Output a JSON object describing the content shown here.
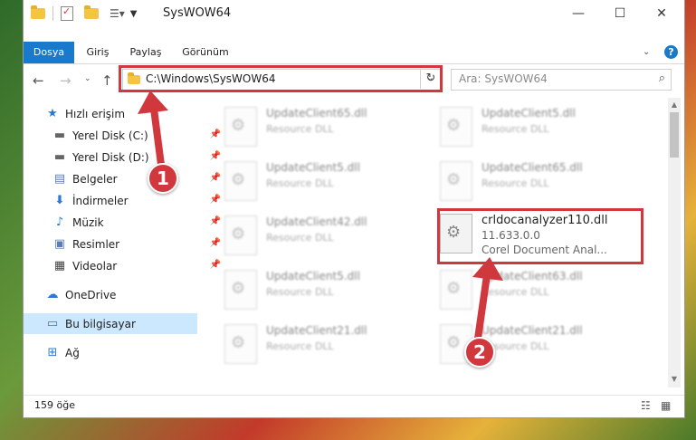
{
  "window": {
    "title": "SysWOW64"
  },
  "ribbon": {
    "tabs": [
      {
        "label": "Dosya",
        "active": true
      },
      {
        "label": "Giriş",
        "active": false
      },
      {
        "label": "Paylaş",
        "active": false
      },
      {
        "label": "Görünüm",
        "active": false
      }
    ],
    "help_label": "?"
  },
  "address": {
    "path": "C:\\Windows\\SysWOW64"
  },
  "search": {
    "placeholder": "Ara: SysWOW64"
  },
  "sidebar": {
    "items": [
      {
        "label": "Hızlı erişim",
        "icon": "star-icon",
        "pinned": false
      },
      {
        "label": "Yerel Disk (C:)",
        "icon": "drive-icon",
        "pinned": true
      },
      {
        "label": "Yerel Disk (D:)",
        "icon": "drive-icon",
        "pinned": true
      },
      {
        "label": "Belgeler",
        "icon": "document-icon",
        "pinned": true
      },
      {
        "label": "İndirmeler",
        "icon": "download-icon",
        "pinned": true
      },
      {
        "label": "Müzik",
        "icon": "music-icon",
        "pinned": true
      },
      {
        "label": "Resimler",
        "icon": "pictures-icon",
        "pinned": true
      },
      {
        "label": "Videolar",
        "icon": "video-icon",
        "pinned": true
      },
      {
        "label": "OneDrive",
        "icon": "cloud-icon",
        "pinned": false
      },
      {
        "label": "Bu bilgisayar",
        "icon": "computer-icon",
        "pinned": false,
        "selected": true
      },
      {
        "label": "Ağ",
        "icon": "network-icon",
        "pinned": false
      }
    ]
  },
  "files": [
    {
      "name": "UpdateClient65.dll",
      "type": "Resource DLL"
    },
    {
      "name": "UpdateClient5.dll",
      "type": "Resource DLL"
    },
    {
      "name": "UpdateClient5.dll",
      "type": "Resource DLL"
    },
    {
      "name": "UpdateClient65.dll",
      "type": "Resource DLL"
    },
    {
      "name": "UpdateClient42.dll",
      "type": "Resource DLL"
    },
    {
      "name": "crldocanalyzer110.dll",
      "version": "11.633.0.0",
      "type": "Corel Document Anal...",
      "highlighted": true
    },
    {
      "name": "UpdateClient5.dll",
      "type": "Resource DLL"
    },
    {
      "name": "UpdateClient63.dll",
      "type": "Resource DLL"
    },
    {
      "name": "UpdateClient21.dll",
      "type": "Resource DLL"
    },
    {
      "name": "UpdateClient21.dll",
      "type": "Resource DLL"
    }
  ],
  "status": {
    "count": "159 öğe"
  },
  "callouts": [
    {
      "number": "1"
    },
    {
      "number": "2"
    }
  ],
  "colors": {
    "accent": "#1979ca",
    "highlight": "#d0383e",
    "selection": "#cce8ff"
  }
}
